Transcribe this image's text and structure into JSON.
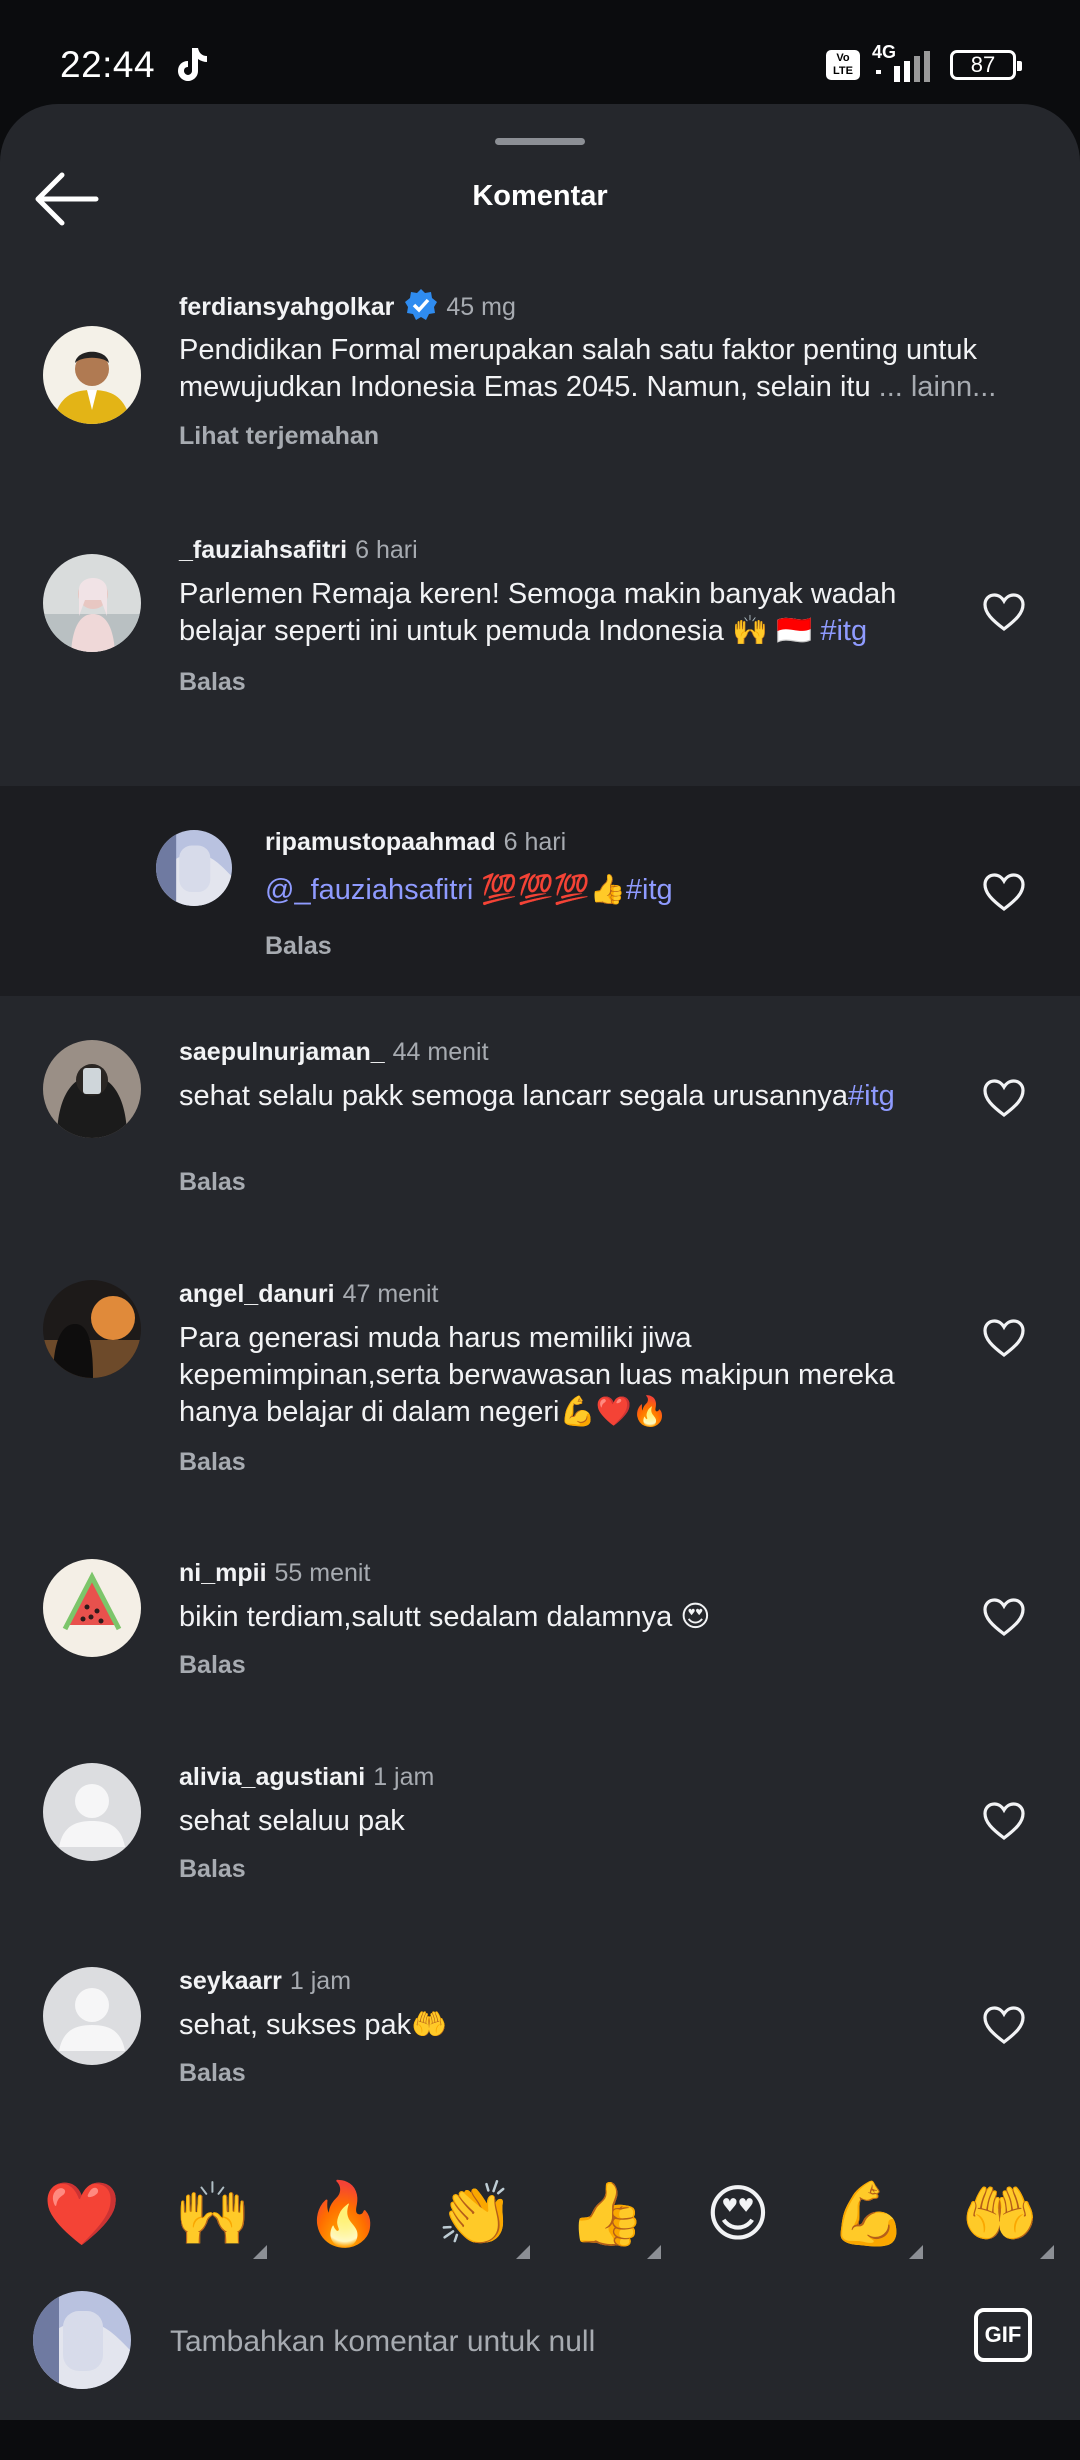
{
  "status_bar": {
    "time": "22:44",
    "network": "4G",
    "battery": "87",
    "volte": "Vo LTE"
  },
  "header": {
    "title": "Komentar"
  },
  "comments": [
    {
      "username": "ferdiansyahgolkar",
      "time": "45 mg",
      "verified": true,
      "text": "Pendidikan Formal merupakan salah satu faktor penting untuk mewujudkan Indonesia Emas 2045. Namun, selain itu",
      "more": "... lainn...",
      "action": "Lihat terjemahan"
    },
    {
      "username": "_fauziahsafitri",
      "time": "6 hari",
      "text": "Parlemen Remaja keren! Semoga makin banyak wadah belajar seperti ini untuk pemuda Indonesia 🙌 🇮🇩",
      "tag": "#itg",
      "action": "Balas"
    },
    {
      "username": "ripamustopaahmad",
      "time": "6 hari",
      "mention": "@_fauziahsafitri",
      "text": " 💯💯💯👍",
      "tag": "#itg",
      "action": "Balas"
    },
    {
      "username": "saepulnurjaman_",
      "time": "44 menit",
      "text": "sehat selalu pakk semoga lancarr segala urusannya",
      "tag": "#itg",
      "action": "Balas"
    },
    {
      "username": "angel_danuri",
      "time": "47 menit",
      "text": "Para generasi muda harus memiliki jiwa kepemimpinan,serta berwawasan luas makipun mereka hanya belajar di dalam negeri💪❤️🔥",
      "action": "Balas"
    },
    {
      "username": "ni_mpii",
      "time": "55 menit",
      "text": "bikin terdiam,salutt sedalam dalamnya 😍",
      "action": "Balas"
    },
    {
      "username": "alivia_agustiani",
      "time": "1 jam",
      "text": "sehat selaluu pak",
      "action": "Balas"
    },
    {
      "username": "seykaarr",
      "time": "1 jam",
      "text": "sehat, sukses pak🤲",
      "action": "Balas"
    }
  ],
  "emoji_bar": [
    "❤️",
    "🙌",
    "🔥",
    "👏",
    "👍",
    "😍",
    "💪",
    "🤲"
  ],
  "composer": {
    "placeholder": "Tambahkan komentar untuk null",
    "gif_label": "GIF"
  },
  "colors": {
    "sheet": "#25272c",
    "highlight": "#1c1d21",
    "link": "#8f9bff",
    "verified": "#2f8cf0"
  }
}
